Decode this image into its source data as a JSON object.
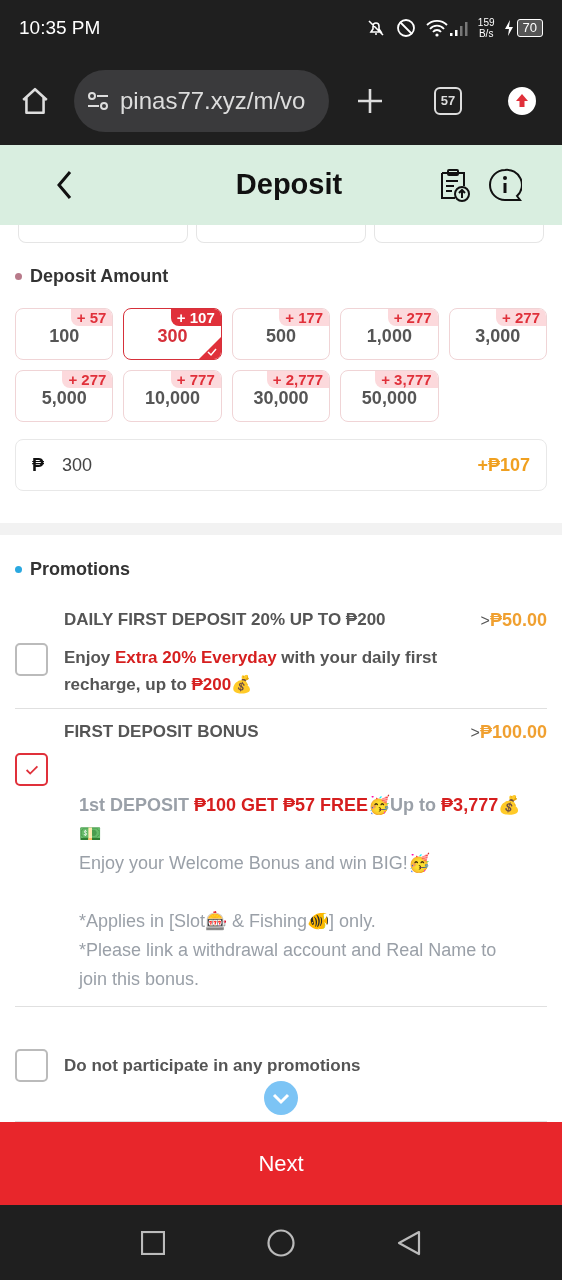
{
  "status_bar": {
    "time": "10:35 PM",
    "net_speed": "159",
    "net_unit": "B/s",
    "battery": "70"
  },
  "browser": {
    "url": "pinas77.xyz/m/vo",
    "tab_count": "57"
  },
  "header": {
    "title": "Deposit"
  },
  "deposit_amount": {
    "title": "Deposit Amount",
    "options": [
      {
        "amount": "100",
        "bonus": "+ 57",
        "selected": false
      },
      {
        "amount": "300",
        "bonus": "+ 107",
        "selected": true
      },
      {
        "amount": "500",
        "bonus": "+ 177",
        "selected": false
      },
      {
        "amount": "1,000",
        "bonus": "+ 277",
        "selected": false
      },
      {
        "amount": "3,000",
        "bonus": "+ 277",
        "selected": false
      },
      {
        "amount": "5,000",
        "bonus": "+ 277",
        "selected": false
      },
      {
        "amount": "10,000",
        "bonus": "+ 777",
        "selected": false
      },
      {
        "amount": "30,000",
        "bonus": "+ 2,777",
        "selected": false
      },
      {
        "amount": "50,000",
        "bonus": "+ 3,777",
        "selected": false
      }
    ],
    "field": {
      "currency": "₱",
      "value": "300",
      "bonus": "+₱107"
    }
  },
  "promotions": {
    "title": "Promotions",
    "items": [
      {
        "title": "DAILY FIRST DEPOSIT 20% UP TO ₱200",
        "amount_prefix": ">",
        "amount": "₱50.00",
        "checked": false,
        "description": [
          "Enjoy **Extra 20% Everyday** with your daily first recharge, up to **₱200**💰"
        ]
      },
      {
        "title": "FIRST DEPOSIT BONUS",
        "amount_prefix": ">",
        "amount": "₱100.00",
        "checked": true,
        "details": [
          "1st DEPOSIT **₱100 GET ₱57 FREE**🥳Up to **₱3,777**💰",
          "💵",
          "Enjoy your Welcome Bonus and win BIG!🥳",
          "*Applies in [Slot🎰 & Fishing🐠] only.",
          "*Please link a withdrawal account and Real Name to join this bonus."
        ]
      }
    ],
    "opt_out": {
      "label": "Do not participate in any promotions",
      "checked": false
    }
  },
  "next_button": "Next"
}
